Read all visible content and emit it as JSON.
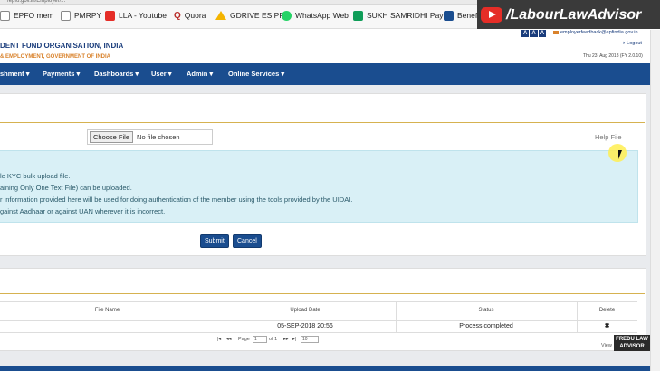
{
  "bookmarks": [
    {
      "label": "EPFO mem",
      "icon": "page-icon",
      "color": "#666666"
    },
    {
      "label": "PMRPY",
      "icon": "page-icon",
      "color": "#666666"
    },
    {
      "label": "LLA - Youtube",
      "icon": "youtube-icon",
      "color": "#e52d27"
    },
    {
      "label": "Quora",
      "icon": "quora-icon",
      "color": "#b92b27"
    },
    {
      "label": "GDRIVE ESIPF",
      "icon": "drive-icon",
      "color": "#4285f4"
    },
    {
      "label": "WhatsApp Web",
      "icon": "whatsapp-icon",
      "color": "#25d366"
    },
    {
      "label": "SUKH SAMRIDHI Pay",
      "icon": "sheet-icon",
      "color": "#0f9d58"
    },
    {
      "label": "Benef",
      "icon": "grid-icon",
      "color": "#1a4d8f"
    }
  ],
  "watermark": {
    "text": "/LabourLawAdvisor",
    "icon": "youtube-icon"
  },
  "header": {
    "org_name": "DENT FUND ORGANISATION, INDIA",
    "ministry": "& EMPLOYMENT, GOVERNMENT OF INDIA",
    "font_sizes": [
      "A",
      "A",
      "A"
    ],
    "email": "employerfeedback@epfindia.gov.in",
    "logout": "Logout",
    "date": "Thu 23, Aug 2018 (FY 2.0.10)"
  },
  "nav": [
    "shment ▾",
    "Payments ▾",
    "Dashboards ▾",
    "User ▾",
    "Admin ▾",
    "Online Services ▾"
  ],
  "upload": {
    "choose_file": "Choose File",
    "no_file": "No file chosen",
    "help_file": "Help File",
    "info_lines": [
      "le KYC bulk upload file.",
      "aining Only One Text File) can be uploaded.",
      "r information provided here will be used for doing authentication of the member using the tools provided by the UIDAI.",
      "gainst Aadhaar or against UAN wherever it is incorrect."
    ],
    "submit": "Submit",
    "cancel": "Cancel"
  },
  "table": {
    "headers": {
      "file_name": "File Name",
      "upload_date": "Upload Date",
      "status": "Status",
      "delete": "Delete"
    },
    "rows": [
      {
        "file_name": "",
        "upload_date": "05-SEP-2018 20:56",
        "status": "Process completed",
        "delete": "✖"
      }
    ],
    "pager": {
      "first": "|◂",
      "prev": "◂◂",
      "page_label": "Page",
      "page": "1",
      "of": "of 1",
      "next": "▸▸",
      "last": "▸|",
      "per_page": "10"
    },
    "view": "View"
  },
  "watermark2": "FREDU LAW ADVISOR"
}
